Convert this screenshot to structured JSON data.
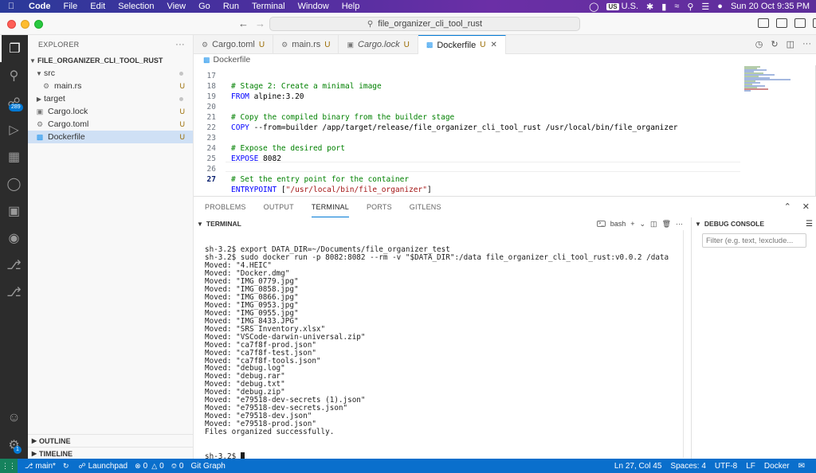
{
  "menubar": {
    "app_name": "Code",
    "items": [
      "File",
      "Edit",
      "Selection",
      "View",
      "Go",
      "Run",
      "Terminal",
      "Window",
      "Help"
    ],
    "input_source": "U.S.",
    "input_badge": "US",
    "datetime": "Sun 20 Oct  9:35 PM"
  },
  "titlebar": {
    "search_text": "file_organizer_cli_tool_rust"
  },
  "activitybar": {
    "scm_badge": "289",
    "accounts_badge": "1"
  },
  "sidebar": {
    "title": "EXPLORER",
    "root": "FILE_ORGANIZER_CLI_TOOL_RUST",
    "items": [
      {
        "label": "src",
        "status": ""
      },
      {
        "label": "main.rs",
        "status": "U"
      },
      {
        "label": "target",
        "status": ""
      },
      {
        "label": "Cargo.lock",
        "status": "U"
      },
      {
        "label": "Cargo.toml",
        "status": "U"
      },
      {
        "label": "Dockerfile",
        "status": "U"
      }
    ],
    "outline_label": "OUTLINE",
    "timeline_label": "TIMELINE"
  },
  "tabs": [
    {
      "label": "Cargo.toml",
      "status": "U"
    },
    {
      "label": "main.rs",
      "status": "U"
    },
    {
      "label": "Cargo.lock",
      "status": "U"
    },
    {
      "label": "Dockerfile",
      "status": "U"
    }
  ],
  "breadcrumb": {
    "file": "Dockerfile"
  },
  "editor": {
    "lines": [
      {
        "n": "17",
        "text": "# Stage 2: Create a minimal image"
      },
      {
        "n": "18",
        "kw": "FROM",
        "rest": " alpine:3.20"
      },
      {
        "n": "19",
        "text": ""
      },
      {
        "n": "20",
        "text": "# Copy the compiled binary from the builder stage"
      },
      {
        "n": "21",
        "kw": "COPY",
        "rest": " --from=builder /app/target/release/file_organizer_cli_tool_rust /usr/local/bin/file_organizer"
      },
      {
        "n": "22",
        "text": ""
      },
      {
        "n": "23",
        "text": "# Expose the desired port"
      },
      {
        "n": "24",
        "kw": "EXPOSE",
        "num": " 8082"
      },
      {
        "n": "25",
        "text": ""
      },
      {
        "n": "26",
        "text": "# Set the entry point for the container"
      },
      {
        "n": "27",
        "kw": "ENTRYPOINT",
        "br1": " [",
        "str": "\"/usr/local/bin/file_organizer\"",
        "br2": "]"
      }
    ]
  },
  "panel": {
    "tabs": [
      "PROBLEMS",
      "OUTPUT",
      "TERMINAL",
      "PORTS",
      "GITLENS"
    ],
    "terminal_label": "TERMINAL",
    "shell": "bash",
    "terminal_lines": [
      "sh-3.2$ export DATA_DIR=~/Documents/file_organizer_test",
      "sh-3.2$ sudo docker run -p 8082:8082 --rm -v \"$DATA_DIR\":/data file_organizer_cli_tool_rust:v0.0.2 /data",
      "Moved: \"4.HEIC\"",
      "Moved: \"Docker.dmg\"",
      "Moved: \"IMG_0779.jpg\"",
      "Moved: \"IMG_0858.jpg\"",
      "Moved: \"IMG_0866.jpg\"",
      "Moved: \"IMG_0953.jpg\"",
      "Moved: \"IMG_0955.jpg\"",
      "Moved: \"IMG_8433.JPG\"",
      "Moved: \"SRS Inventory.xlsx\"",
      "Moved: \"VSCode-darwin-universal.zip\"",
      "Moved: \"ca7f8f-prod.json\"",
      "Moved: \"ca7f8f-test.json\"",
      "Moved: \"ca7f8f-tools.json\"",
      "Moved: \"debug.log\"",
      "Moved: \"debug.rar\"",
      "Moved: \"debug.txt\"",
      "Moved: \"debug.zip\"",
      "Moved: \"e79518-dev-secrets (1).json\"",
      "Moved: \"e79518-dev-secrets.json\"",
      "Moved: \"e79518-dev.json\"",
      "Moved: \"e79518-prod.json\"",
      "Files organized successfully."
    ],
    "prompt": "sh-3.2$ ",
    "debug_label": "DEBUG CONSOLE",
    "debug_filter_placeholder": "Filter (e.g. text, !exclude..."
  },
  "statusbar": {
    "branch": "main*",
    "launchpad": "Launchpad",
    "errors": "0",
    "warnings": "0",
    "ports": "0",
    "git_graph": "Git Graph",
    "position": "Ln 27, Col 45",
    "spaces": "Spaces: 4",
    "encoding": "UTF-8",
    "eol": "LF",
    "language": "Docker"
  },
  "colors": {
    "accent": "#0078d4",
    "statusbar": "#0a6fcc",
    "activitybar": "#2c2c2c",
    "untracked": "#9a6b00"
  }
}
